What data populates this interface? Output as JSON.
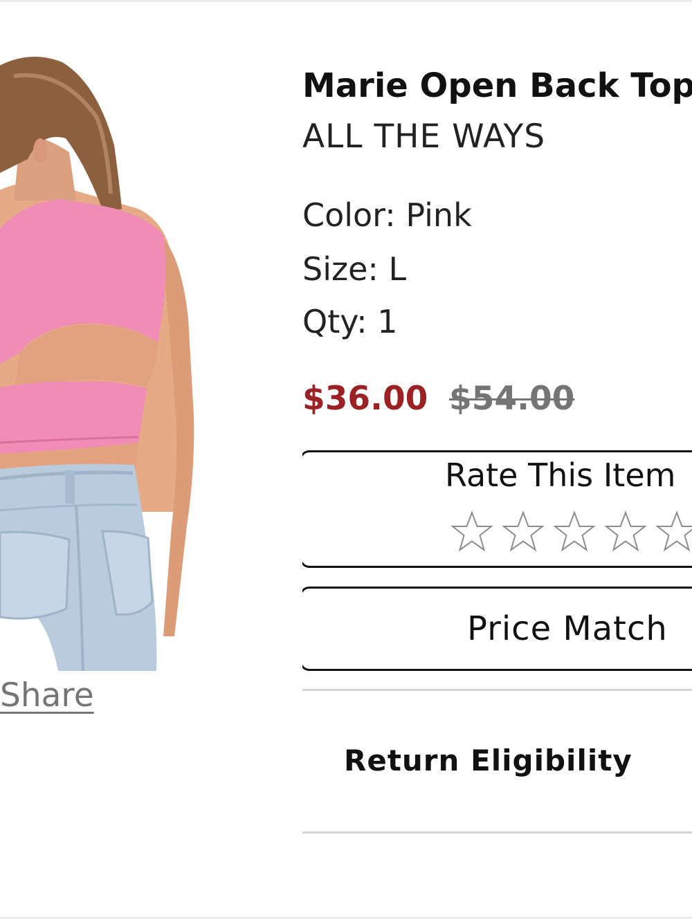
{
  "product": {
    "title": "Marie Open Back Top",
    "brand": "ALL THE WAYS",
    "color_line": "Color: Pink",
    "size_line": "Size: L",
    "qty_line": "Qty: 1",
    "sale_price": "$36.00",
    "original_price": "$54.00",
    "image_icon": "product-photo"
  },
  "share": {
    "label": "Share"
  },
  "rating": {
    "label": "Rate This Item",
    "stars_total": 5,
    "stars_filled": 0
  },
  "price_match": {
    "label": "Price Match"
  },
  "returns": {
    "label": "Return Eligibility"
  },
  "colors": {
    "sale_price": "#9b2124",
    "original_price": "#757575",
    "top_pink": "#f08cb6",
    "denim": "#b9ccde"
  }
}
